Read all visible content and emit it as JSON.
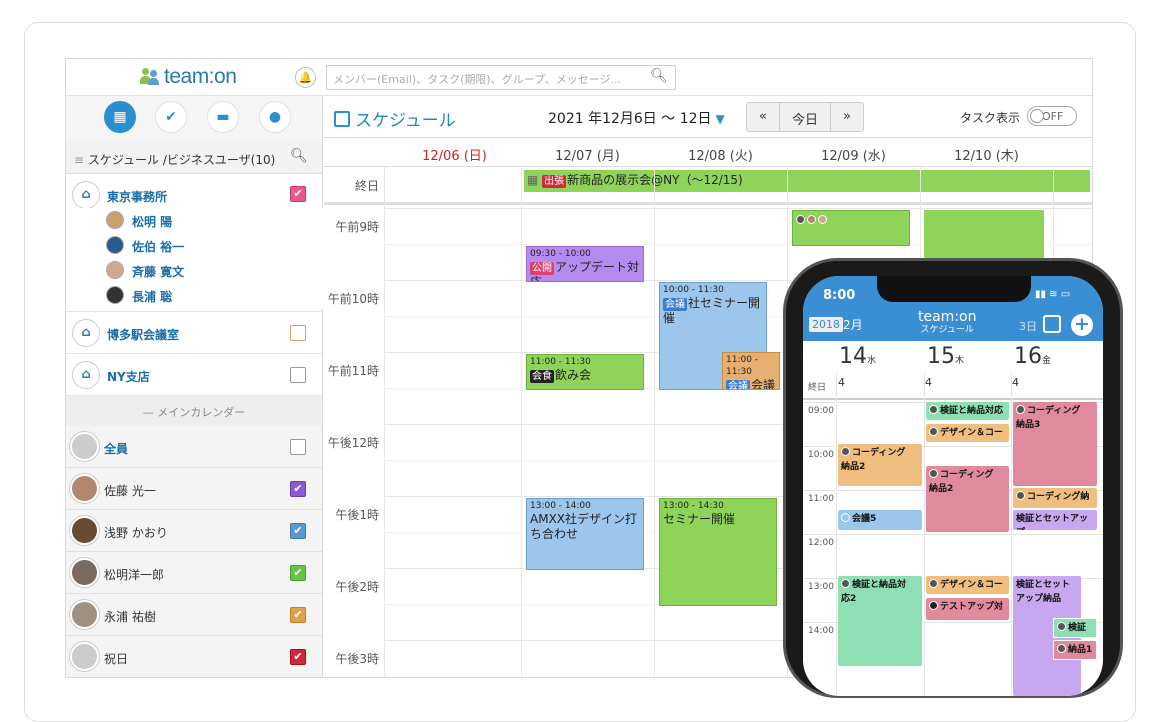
{
  "app": {
    "logo": "team:on",
    "search_placeholder": "メンバー(Email)、タスク(期限)、グループ、メッセージ..."
  },
  "sidebar": {
    "header": "スケジュール /ビジネスユーザ(10)",
    "facilities": [
      {
        "name": "東京事務所",
        "checked": true,
        "color": "#e85a8a"
      },
      {
        "name": "博多駅会議室",
        "checked": false,
        "color": "#e39a5a"
      },
      {
        "name": "NY支店",
        "checked": false,
        "color": "#888888"
      }
    ],
    "members": [
      "松明 陽",
      "佐伯 裕一",
      "斉藤 寛文",
      "長浦 聡"
    ],
    "divider": "メインカレンダー",
    "people": [
      {
        "name": "全員",
        "checked": false,
        "color": "#888888"
      },
      {
        "name": "佐藤 光一",
        "checked": true,
        "color": "#8a5ad0"
      },
      {
        "name": "浅野 かおり",
        "checked": true,
        "color": "#5a9ad0"
      },
      {
        "name": "松明洋一郎",
        "checked": true,
        "color": "#6ac04a"
      },
      {
        "name": "永浦 祐樹",
        "checked": true,
        "color": "#e3a04a"
      },
      {
        "name": "祝日",
        "checked": true,
        "color": "#d02a3a"
      }
    ]
  },
  "main": {
    "title": "スケジュール",
    "date_range": "2021 年12月6日 〜 12日",
    "nav": {
      "prev": "«",
      "today": "今日",
      "next": "»"
    },
    "task_label": "タスク表示",
    "toggle": "OFF",
    "days": [
      "12/06 (日)",
      "12/07 (月)",
      "12/08 (火)",
      "12/09 (水)",
      "12/10 (木)"
    ],
    "allday_label": "終日",
    "allday_event": {
      "tag": "出張",
      "text": "新商品の展示会@NY（〜12/15)"
    },
    "hours": [
      "午前9時",
      "午前10時",
      "午前11時",
      "午後12時",
      "午後1時",
      "午後2時",
      "午後3時"
    ],
    "events": [
      {
        "time": "09:30 - 10:00",
        "tag": "公開",
        "text": "アップデート対応"
      },
      {
        "time": "10:00 - 11:30",
        "tag": "会議",
        "text": "社セミナー開催"
      },
      {
        "time": "11:00 - 11:30",
        "tag": "会議",
        "text": "会議"
      },
      {
        "time": "11:00 - 11:30",
        "tag": "会食",
        "text": "飲み会"
      },
      {
        "time": "13:00 - 14:00",
        "tag": "",
        "text": "AMXX社デザイン打ち合わせ"
      },
      {
        "time": "13:00 - 14:30",
        "tag": "",
        "text": "セミナー開催"
      }
    ]
  },
  "phone": {
    "time": "8:00",
    "year": "2018",
    "month": "2月",
    "logo": "team:on",
    "logo_sub": "スケジュール",
    "view": "3日",
    "days": [
      {
        "num": "14",
        "wd": "水"
      },
      {
        "num": "15",
        "wd": "木"
      },
      {
        "num": "16",
        "wd": "金"
      }
    ],
    "counts": [
      "4",
      "4",
      "4"
    ],
    "allday": "終日",
    "hours": [
      "09:00",
      "10:00",
      "11:00",
      "12:00",
      "13:00",
      "14:00"
    ],
    "events": [
      "検証と納品対応",
      "デザイン＆コー",
      "コーディング",
      "納品3",
      "コーディング",
      "納品2",
      "コーディング",
      "納品2",
      "コーディング納",
      "会議5",
      "検証とセットアップ",
      "検証と納品対",
      "応2",
      "デザイン＆コー",
      "テストアップ対",
      "検証とセット",
      "アップ納品",
      "検証と",
      "納品1"
    ]
  }
}
